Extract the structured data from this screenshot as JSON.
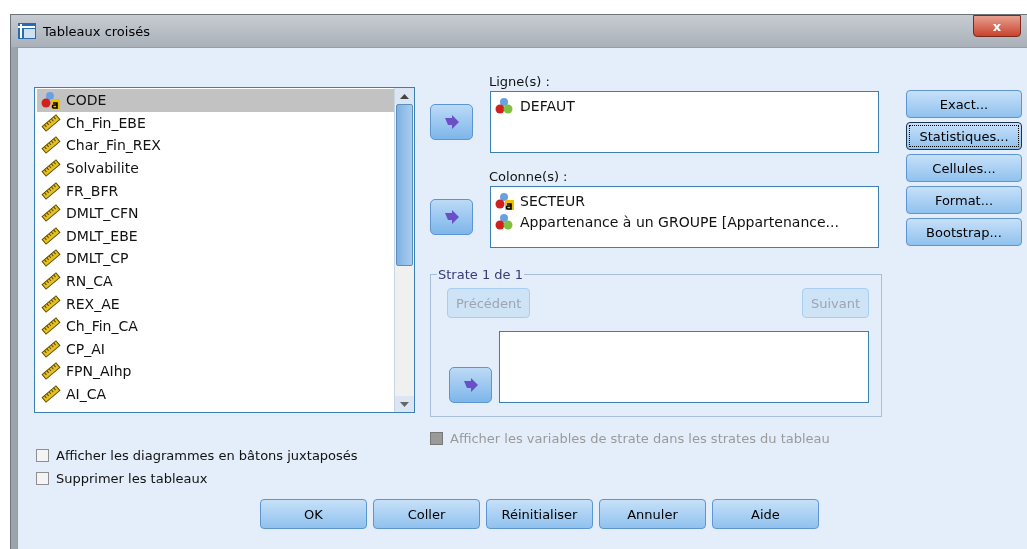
{
  "window": {
    "title": "Tableaux croisés",
    "close": "x"
  },
  "variables": [
    {
      "name": "CODE",
      "kind": "string",
      "selected": true
    },
    {
      "name": "Ch_Fin_EBE",
      "kind": "scale",
      "selected": false
    },
    {
      "name": "Char_Fin_REX",
      "kind": "scale",
      "selected": false
    },
    {
      "name": "Solvabilite",
      "kind": "scale",
      "selected": false
    },
    {
      "name": "FR_BFR",
      "kind": "scale",
      "selected": false
    },
    {
      "name": "DMLT_CFN",
      "kind": "scale",
      "selected": false
    },
    {
      "name": "DMLT_EBE",
      "kind": "scale",
      "selected": false
    },
    {
      "name": "DMLT_CP",
      "kind": "scale",
      "selected": false
    },
    {
      "name": "RN_CA",
      "kind": "scale",
      "selected": false
    },
    {
      "name": "REX_AE",
      "kind": "scale",
      "selected": false
    },
    {
      "name": "Ch_Fin_CA",
      "kind": "scale",
      "selected": false
    },
    {
      "name": "CP_AI",
      "kind": "scale",
      "selected": false
    },
    {
      "name": "FPN_AIhp",
      "kind": "scale",
      "selected": false
    },
    {
      "name": "AI_CA",
      "kind": "scale",
      "selected": false
    }
  ],
  "rows": {
    "label": "Ligne(s) :",
    "items": [
      {
        "name": "DEFAUT",
        "kind": "nominal"
      }
    ]
  },
  "columns": {
    "label": "Colonne(s) :",
    "items": [
      {
        "name": "SECTEUR",
        "kind": "string"
      },
      {
        "name": "Appartenance à un GROUPE [Appartenance...",
        "kind": "nominal"
      }
    ]
  },
  "layer": {
    "title": "Strate 1 de 1",
    "previous": {
      "label": "Précédent",
      "disabled": true
    },
    "next": {
      "label": "Suivant",
      "disabled": true
    }
  },
  "layer_option": {
    "label": "Afficher les variables de strate dans les strates du tableau",
    "checked": false,
    "disabled": true
  },
  "side_buttons": [
    {
      "label": "Exact...",
      "focused": false
    },
    {
      "label": "Statistiques...",
      "focused": true
    },
    {
      "label": "Cellules...",
      "focused": false
    },
    {
      "label": "Format...",
      "focused": false
    },
    {
      "label": "Bootstrap...",
      "focused": false
    }
  ],
  "options": [
    {
      "label": "Afficher les diagrammes en bâtons juxtaposés",
      "checked": false
    },
    {
      "label": "Supprimer les tableaux",
      "checked": false
    }
  ],
  "buttons": [
    "OK",
    "Coller",
    "Réinitialiser",
    "Annuler",
    "Aide"
  ]
}
